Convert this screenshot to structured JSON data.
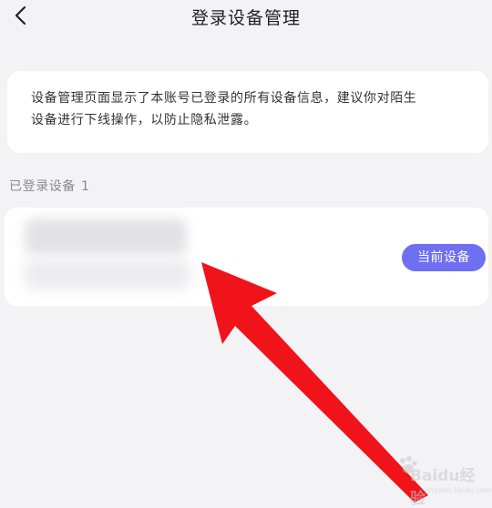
{
  "header": {
    "title": "登录设备管理",
    "back_icon": "chevron-left-icon"
  },
  "info_card": {
    "line1": "设备管理页面显示了本账号已登录的所有设备信息，建议你对陌生",
    "line2": "设备进行下线操作，以防止隐私泄露。"
  },
  "devices_section": {
    "label": "已登录设备",
    "count": "1"
  },
  "device": {
    "badge": "当前设备"
  },
  "annotation": {
    "arrow_color": "#f0131a"
  },
  "watermark": {
    "text": "Baidu经验",
    "sub": "jingyan.baidu.com"
  },
  "colors": {
    "background": "#f3f3f6",
    "card": "#ffffff",
    "badge": "#6f6ff2"
  }
}
